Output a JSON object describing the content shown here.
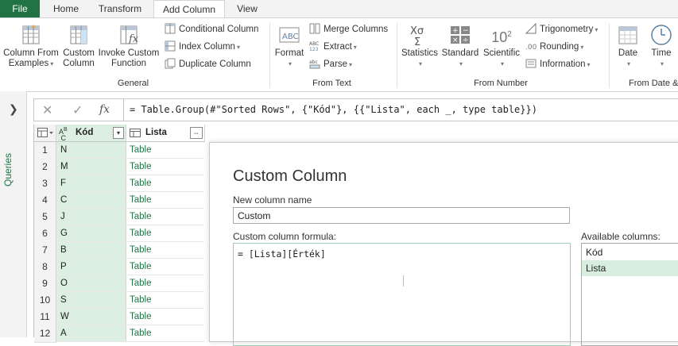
{
  "tabs": [
    "File",
    "Home",
    "Transform",
    "Add Column",
    "View"
  ],
  "ribbon": {
    "general": {
      "label": "General",
      "column_from_examples": [
        "Column From",
        "Examples"
      ],
      "custom_column": [
        "Custom",
        "Column"
      ],
      "invoke_custom_function": [
        "Invoke Custom",
        "Function"
      ],
      "conditional_column": "Conditional Column",
      "index_column": "Index Column",
      "duplicate_column": "Duplicate Column"
    },
    "from_text": {
      "label": "From Text",
      "format": "Format",
      "merge_columns": "Merge Columns",
      "extract": "Extract",
      "parse": "Parse"
    },
    "from_number": {
      "label": "From Number",
      "statistics": "Statistics",
      "standard": "Standard",
      "scientific": "Scientific",
      "scientific_icon_text": "10",
      "scientific_icon_sup": "2",
      "trigonometry": "Trigonometry",
      "rounding": "Rounding",
      "information": "Information"
    },
    "from_date": {
      "label": "From Date &",
      "date": "Date",
      "time": "Time"
    }
  },
  "queries_panel": {
    "label": "Queries"
  },
  "formula_bar": {
    "fx": "fx",
    "formula": "= Table.Group(#\"Sorted Rows\", {\"Kód\"}, {{\"Lista\", each _, type table}})"
  },
  "grid": {
    "columns": [
      {
        "name": "Kód",
        "type_icon": "ABC"
      },
      {
        "name": "Lista",
        "type_icon": "table"
      }
    ],
    "rows": [
      {
        "n": "1",
        "kod": "N",
        "lista": "Table"
      },
      {
        "n": "2",
        "kod": "M",
        "lista": "Table"
      },
      {
        "n": "3",
        "kod": "F",
        "lista": "Table"
      },
      {
        "n": "4",
        "kod": "C",
        "lista": "Table"
      },
      {
        "n": "5",
        "kod": "J",
        "lista": "Table"
      },
      {
        "n": "6",
        "kod": "G",
        "lista": "Table"
      },
      {
        "n": "7",
        "kod": "B",
        "lista": "Table"
      },
      {
        "n": "8",
        "kod": "P",
        "lista": "Table"
      },
      {
        "n": "9",
        "kod": "O",
        "lista": "Table"
      },
      {
        "n": "10",
        "kod": "S",
        "lista": "Table"
      },
      {
        "n": "11",
        "kod": "W",
        "lista": "Table"
      },
      {
        "n": "12",
        "kod": "A",
        "lista": "Table"
      }
    ]
  },
  "dialog": {
    "title": "Custom Column",
    "new_column_name_label": "New column name",
    "new_column_name_value": "Custom",
    "formula_label": "Custom column formula:",
    "formula_value": "= [Lista][Érték]",
    "available_label": "Available columns:",
    "available_columns": [
      "Kód",
      "Lista"
    ]
  },
  "colors": {
    "accent": "#217346",
    "column_highlight": "#dcefe2",
    "selected_item": "#d8eedf"
  }
}
